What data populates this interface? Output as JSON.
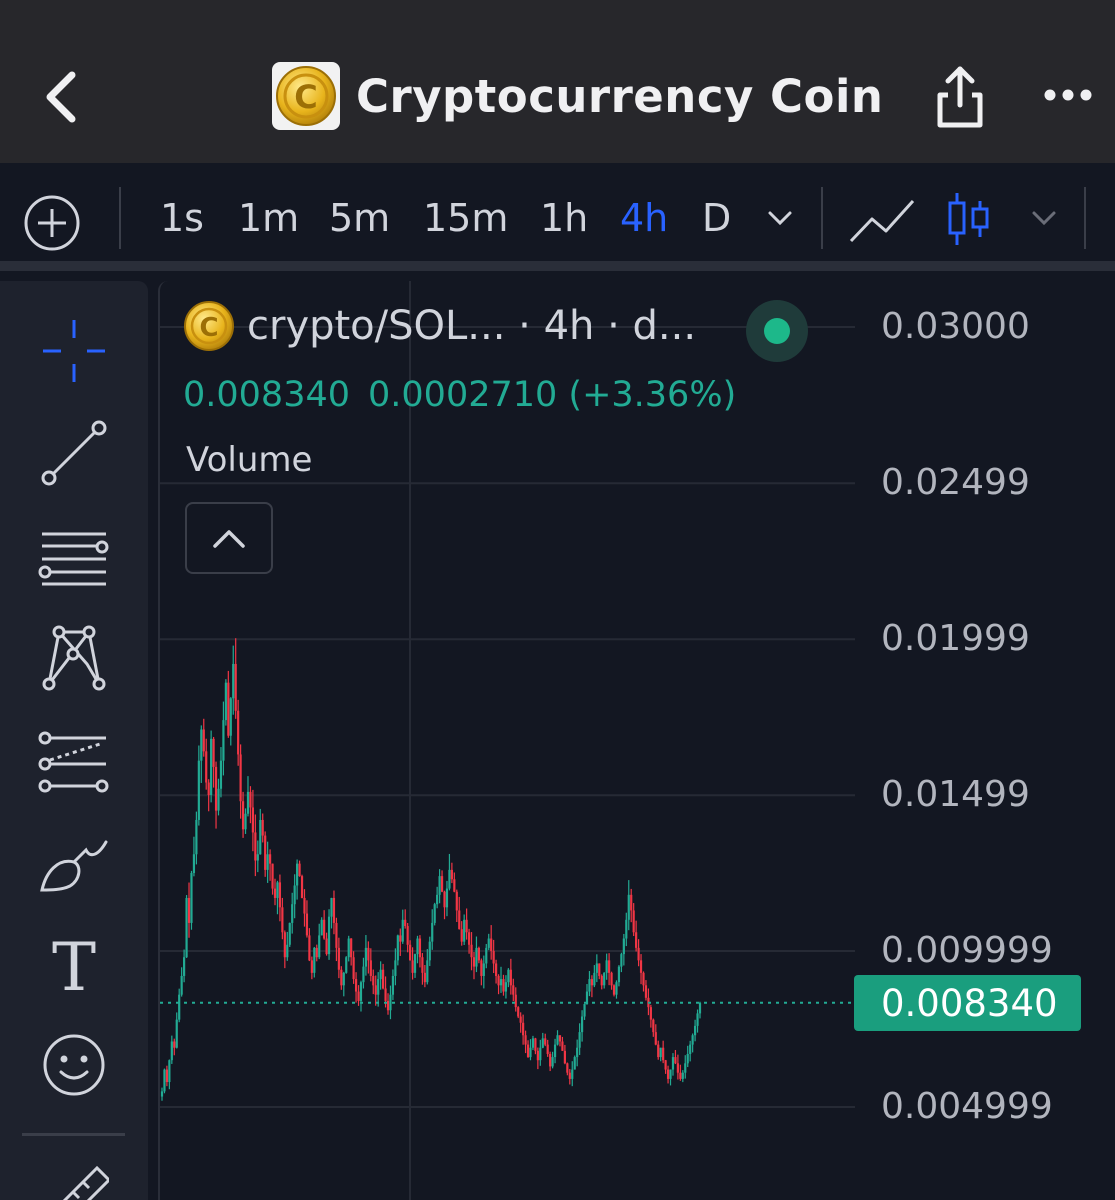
{
  "header": {
    "title": "Cryptocurrency Coin",
    "coin_glyph": "C"
  },
  "toolbar": {
    "timeframes": [
      {
        "label": "1s",
        "active": false
      },
      {
        "label": "1m",
        "active": false
      },
      {
        "label": "5m",
        "active": false
      },
      {
        "label": "15m",
        "active": false
      },
      {
        "label": "1h",
        "active": false
      },
      {
        "label": "4h",
        "active": true
      },
      {
        "label": "D",
        "active": false
      }
    ],
    "active_color": "#2962ff"
  },
  "sidebar": {
    "tools": [
      "crosshair-icon",
      "trend-line-icon",
      "parallel-channel-icon",
      "pattern-icon",
      "projection-icon",
      "brush-icon",
      "text-icon",
      "emoji-icon",
      "ruler-icon"
    ],
    "text_tool_glyph": "T"
  },
  "legend": {
    "symbol": "crypto/SOL... · 4h · d...",
    "last_price": "0.008340",
    "change": "0.0002710 (+3.36%)",
    "volume_label": "Volume"
  },
  "axis": {
    "labels": [
      "0.03000",
      "0.02499",
      "0.01999",
      "0.01499",
      "0.009999",
      "0.004999"
    ]
  },
  "current_price_tag": "0.008340",
  "colors": {
    "up": "#22ab94",
    "down": "#f23645",
    "accent": "#2962ff",
    "background": "#131722"
  },
  "chart_data": {
    "type": "candlestick",
    "timeframe": "4h",
    "ylim": [
      0.003,
      0.031
    ],
    "y_ticks": [
      0.03,
      0.02499,
      0.01999,
      0.01499,
      0.009999,
      0.004999
    ],
    "last_price": 0.00834,
    "close_path": [
      0.0055,
      0.0062,
      0.0058,
      0.0065,
      0.0071,
      0.0069,
      0.0078,
      0.0086,
      0.0092,
      0.0098,
      0.0117,
      0.0109,
      0.0125,
      0.0131,
      0.0142,
      0.0161,
      0.0171,
      0.0164,
      0.0154,
      0.015,
      0.0168,
      0.0159,
      0.0145,
      0.0152,
      0.0161,
      0.0174,
      0.0186,
      0.0169,
      0.0181,
      0.0192,
      0.0177,
      0.0163,
      0.0148,
      0.0139,
      0.0144,
      0.0151,
      0.0146,
      0.0138,
      0.0129,
      0.0131,
      0.0142,
      0.0137,
      0.0126,
      0.0131,
      0.0128,
      0.012,
      0.0117,
      0.0122,
      0.0114,
      0.0106,
      0.0098,
      0.0102,
      0.0109,
      0.0115,
      0.0121,
      0.0128,
      0.0124,
      0.0117,
      0.0112,
      0.0105,
      0.0097,
      0.0093,
      0.0101,
      0.0098,
      0.0105,
      0.011,
      0.0104,
      0.0099,
      0.0111,
      0.0117,
      0.0109,
      0.0101,
      0.0094,
      0.0089,
      0.0093,
      0.0098,
      0.0104,
      0.0098,
      0.0091,
      0.0087,
      0.0084,
      0.009,
      0.0095,
      0.0101,
      0.0097,
      0.0092,
      0.0089,
      0.0086,
      0.0091,
      0.0094,
      0.0088,
      0.0084,
      0.0081,
      0.0086,
      0.0092,
      0.0097,
      0.0105,
      0.0103,
      0.011,
      0.0108,
      0.0102,
      0.0097,
      0.0093,
      0.0099,
      0.0104,
      0.0098,
      0.0093,
      0.009,
      0.0097,
      0.0103,
      0.0109,
      0.0115,
      0.0118,
      0.0124,
      0.0119,
      0.0114,
      0.012,
      0.0126,
      0.0123,
      0.0119,
      0.0113,
      0.0107,
      0.0103,
      0.011,
      0.0106,
      0.0102,
      0.0098,
      0.0095,
      0.0101,
      0.0097,
      0.0092,
      0.0096,
      0.0101,
      0.0104,
      0.01,
      0.0096,
      0.0092,
      0.0089,
      0.0091,
      0.0087,
      0.009,
      0.0094,
      0.0089,
      0.0086,
      0.0082,
      0.0079,
      0.0077,
      0.0073,
      0.007,
      0.0066,
      0.0069,
      0.0072,
      0.0068,
      0.0065,
      0.0069,
      0.0072,
      0.007,
      0.0067,
      0.0063,
      0.0066,
      0.007,
      0.0073,
      0.0071,
      0.0068,
      0.0064,
      0.0061,
      0.0059,
      0.0062,
      0.0066,
      0.0069,
      0.0074,
      0.0079,
      0.0083,
      0.0087,
      0.0091,
      0.0089,
      0.0093,
      0.0096,
      0.0092,
      0.0089,
      0.0093,
      0.0097,
      0.0093,
      0.0089,
      0.0086,
      0.009,
      0.0095,
      0.0099,
      0.0104,
      0.011,
      0.0118,
      0.0113,
      0.0106,
      0.0101,
      0.0097,
      0.0093,
      0.0089,
      0.0085,
      0.0082,
      0.0078,
      0.0074,
      0.007,
      0.0066,
      0.0069,
      0.0065,
      0.0062,
      0.0059,
      0.0062,
      0.0066,
      0.0064,
      0.0061,
      0.0059,
      0.0061,
      0.0064,
      0.0067,
      0.007,
      0.0073,
      0.0076,
      0.008,
      0.00834
    ]
  }
}
